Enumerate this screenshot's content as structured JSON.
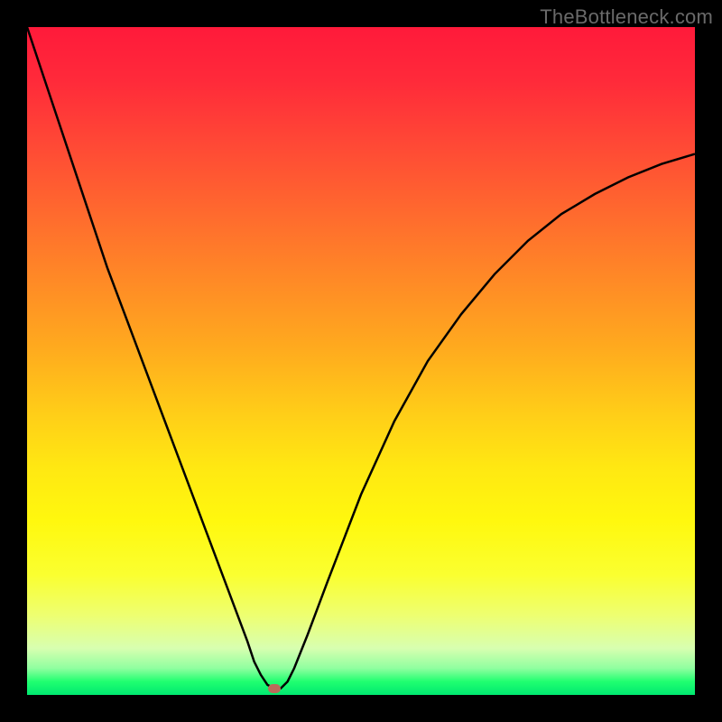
{
  "watermark": "TheBottleneck.com",
  "chart_data": {
    "type": "line",
    "title": "",
    "xlabel": "",
    "ylabel": "",
    "xlim": [
      0,
      100
    ],
    "ylim": [
      0,
      100
    ],
    "grid": false,
    "legend": false,
    "x": [
      0,
      3,
      6,
      9,
      12,
      15,
      18,
      21,
      24,
      27,
      30,
      33,
      34,
      35,
      36,
      37,
      38,
      39,
      40,
      42,
      45,
      50,
      55,
      60,
      65,
      70,
      75,
      80,
      85,
      90,
      95,
      100
    ],
    "values": [
      100,
      91,
      82,
      73,
      64,
      56,
      48,
      40,
      32,
      24,
      16,
      8,
      5,
      3,
      1.5,
      1,
      1,
      2,
      4,
      9,
      17,
      30,
      41,
      50,
      57,
      63,
      68,
      72,
      75,
      77.5,
      79.5,
      81
    ],
    "marker": {
      "x": 37,
      "y": 1
    },
    "annotations": []
  }
}
